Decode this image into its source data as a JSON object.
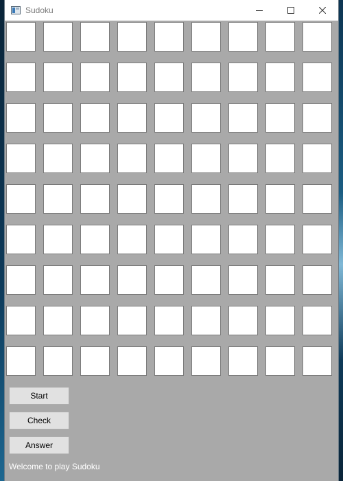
{
  "window": {
    "title": "Sudoku",
    "controls": {
      "minimize": "minimize-icon",
      "maximize": "maximize-icon",
      "close": "close-icon"
    }
  },
  "board": {
    "rows": 9,
    "cols": 9,
    "cells": [
      [
        "",
        "",
        "",
        "",
        "",
        "",
        "",
        "",
        ""
      ],
      [
        "",
        "",
        "",
        "",
        "",
        "",
        "",
        "",
        ""
      ],
      [
        "",
        "",
        "",
        "",
        "",
        "",
        "",
        "",
        ""
      ],
      [
        "",
        "",
        "",
        "",
        "",
        "",
        "",
        "",
        ""
      ],
      [
        "",
        "",
        "",
        "",
        "",
        "",
        "",
        "",
        ""
      ],
      [
        "",
        "",
        "",
        "",
        "",
        "",
        "",
        "",
        ""
      ],
      [
        "",
        "",
        "",
        "",
        "",
        "",
        "",
        "",
        ""
      ],
      [
        "",
        "",
        "",
        "",
        "",
        "",
        "",
        "",
        ""
      ],
      [
        "",
        "",
        "",
        "",
        "",
        "",
        "",
        "",
        ""
      ]
    ]
  },
  "buttons": {
    "start": "Start",
    "check": "Check",
    "answer": "Answer"
  },
  "status": "Welcome to play Sudoku",
  "colors": {
    "window_background": "#a9a9a9",
    "cell_background": "#ffffff",
    "button_background": "#e1e1e1"
  }
}
